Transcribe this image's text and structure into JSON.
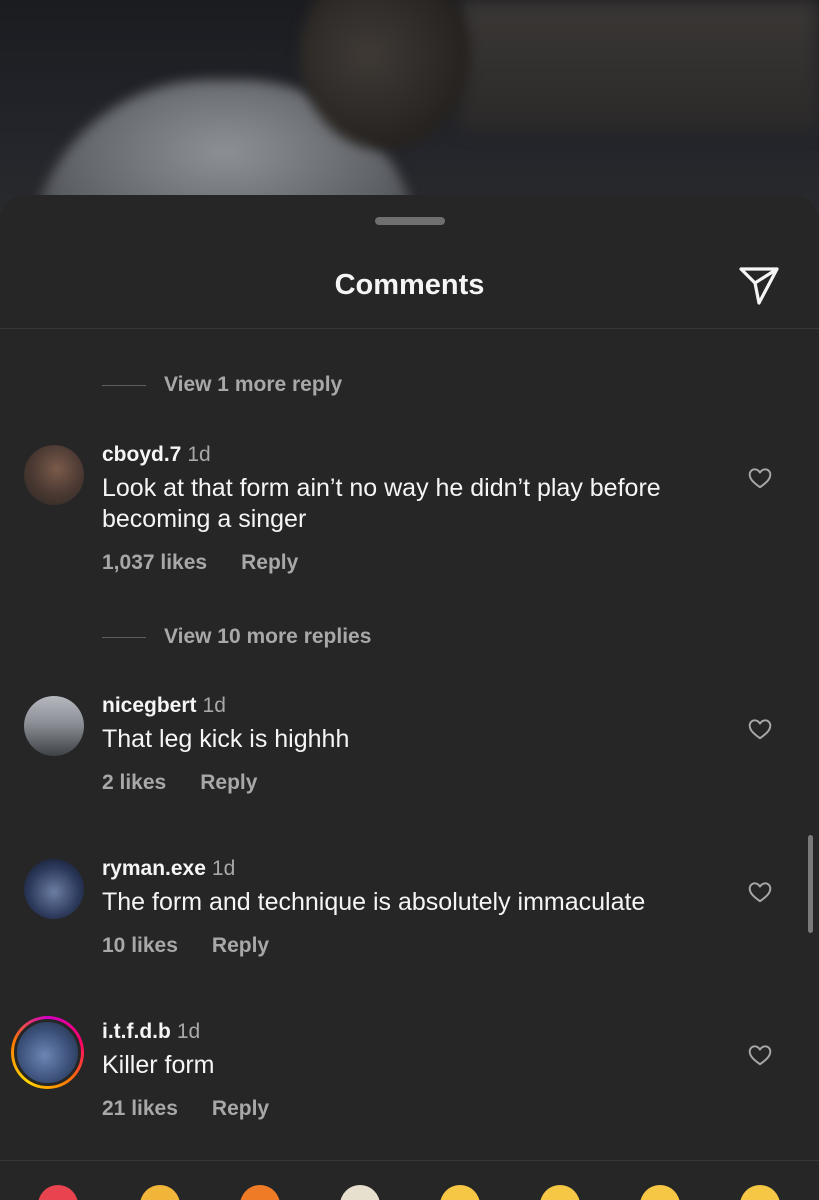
{
  "header": {
    "title": "Comments",
    "share_icon": "paper-plane-icon"
  },
  "threads": [
    {
      "view_more": "View 1 more reply"
    },
    {
      "view_more": "View 10 more replies"
    }
  ],
  "comments": [
    {
      "username": "cboyd.7",
      "time": "1d",
      "text": "Look at that form ain’t no way he didn’t play before becoming a singer",
      "likes": "1,037 likes",
      "reply": "Reply"
    },
    {
      "username": "nicegbert",
      "time": "1d",
      "text": "That leg kick is highhh",
      "likes": "2 likes",
      "reply": "Reply"
    },
    {
      "username": "ryman.exe",
      "time": "1d",
      "text": "The form and technique is absolutely immaculate",
      "likes": "10 likes",
      "reply": "Reply"
    },
    {
      "username": "i.t.f.d.b",
      "time": "1d",
      "text": "Killer form",
      "likes": "21 likes",
      "reply": "Reply"
    }
  ],
  "colors": {
    "sheet_background": "#262626",
    "primary_text": "#f5f5f5",
    "secondary_text": "#a8a8a8",
    "story_ring": "#ff0069"
  }
}
